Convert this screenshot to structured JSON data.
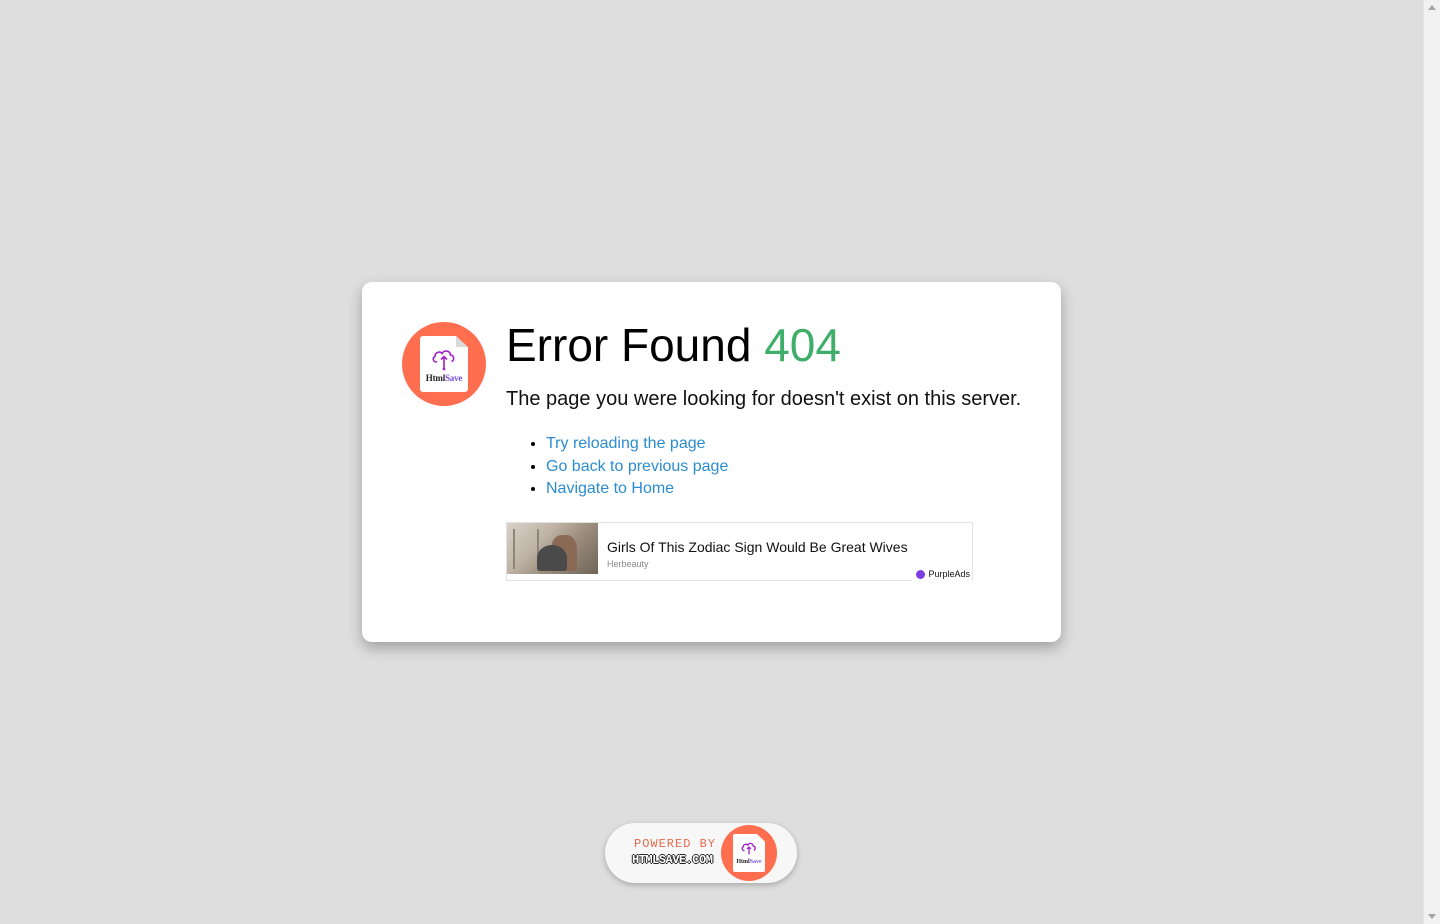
{
  "error": {
    "title_prefix": "Error Found",
    "code": "404",
    "message": "The page you were looking for doesn't exist on this server."
  },
  "logo": {
    "brand_html": "Html",
    "brand_save": "Save",
    "icon": "cloud-upload-icon"
  },
  "links": [
    {
      "label": "Try reloading the page"
    },
    {
      "label": "Go back to previous page"
    },
    {
      "label": "Navigate to Home"
    }
  ],
  "ad": {
    "headline": "Girls Of This Zodiac Sign Would Be Great Wives",
    "source": "Herbeauty",
    "network": "PurpleAds"
  },
  "powered": {
    "line1": "POWERED BY",
    "line2": "HTMLSAVE.COM"
  },
  "colors": {
    "background": "#dedede",
    "accent_code": "#3fae6a",
    "link": "#2b8ccf",
    "logo_circle": "#ff6f4f",
    "purple": "#7b3fe4"
  }
}
